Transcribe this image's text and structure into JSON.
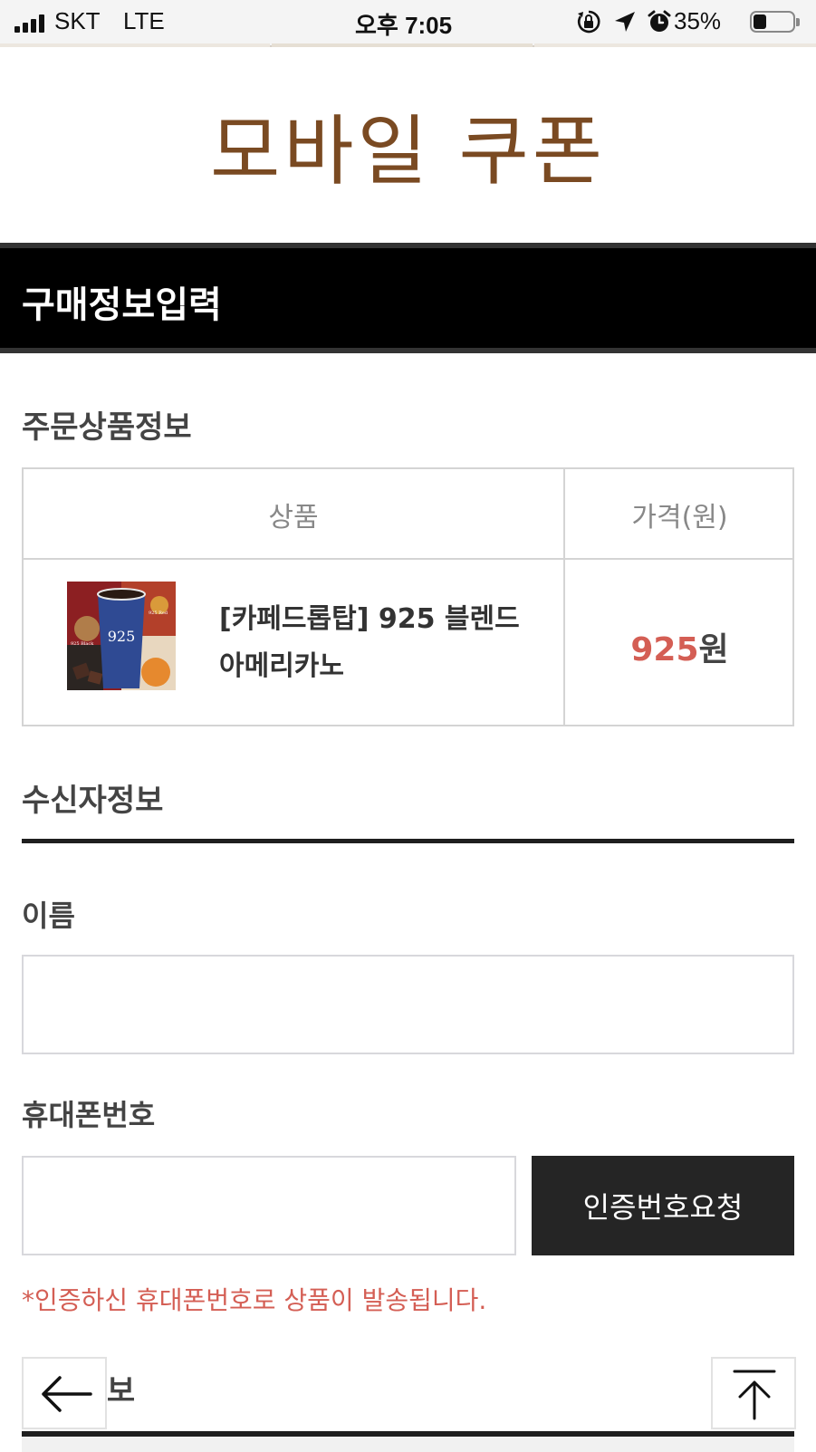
{
  "status_bar": {
    "carrier": "SKT",
    "network": "LTE",
    "time": "오후 7:05",
    "battery": "35%",
    "battery_level": 0.35
  },
  "header": {
    "logo_text": "모바일 쿠폰"
  },
  "section": {
    "title": "구매정보입력"
  },
  "order_info": {
    "heading": "주문상품정보",
    "columns": [
      "상품",
      "가격(원)"
    ],
    "item": {
      "name": "[카페드롭탑] 925 블렌드 아메리카노",
      "price_value": "925",
      "price_unit": "원",
      "image_labels": {
        "center": "925",
        "left": "925 Black",
        "right": "925 Red"
      }
    }
  },
  "recipient": {
    "heading": "수신자정보",
    "name_label": "이름",
    "name_value": "",
    "phone_label": "휴대폰번호",
    "phone_value": "",
    "request_button": "인증번호요청",
    "notice": "*인증하신 휴대폰번호로 상품이 발송됩니다."
  },
  "payment": {
    "heading": "결제정보"
  },
  "colors": {
    "brand_brown": "#7a4a22",
    "accent_red": "#d45e54",
    "dark_button": "#252525"
  },
  "icons": [
    "signal-icon",
    "orientation-lock-icon",
    "location-arrow-icon",
    "alarm-icon",
    "battery-icon",
    "back-arrow-icon",
    "scroll-top-icon"
  ]
}
